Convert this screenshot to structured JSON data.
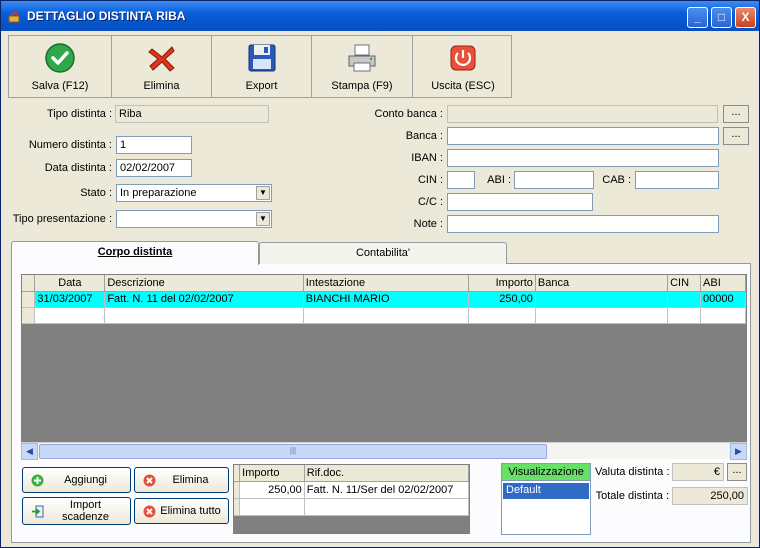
{
  "window": {
    "title": "DETTAGLIO DISTINTA RIBA",
    "controls": [
      "_",
      "□",
      "X"
    ]
  },
  "toolbar": {
    "buttons": [
      {
        "label": "Salva (F12)",
        "icon": "check-icon"
      },
      {
        "label": "Elimina",
        "icon": "delete-x-icon"
      },
      {
        "label": "Export",
        "icon": "floppy-disk-icon"
      },
      {
        "label": "Stampa (F9)",
        "icon": "printer-icon"
      },
      {
        "label": "Uscita (ESC)",
        "icon": "power-icon"
      }
    ]
  },
  "form": {
    "tipo_distinta": {
      "label": "Tipo distinta :",
      "value": "Riba"
    },
    "numero_distinta": {
      "label": "Numero distinta :",
      "value": "1"
    },
    "data_distinta": {
      "label": "Data distinta :",
      "value": "02/02/2007"
    },
    "stato": {
      "label": "Stato :",
      "value": "In preparazione"
    },
    "tipo_presentazione": {
      "label": "Tipo presentazione :",
      "value": ""
    },
    "conto_banca": {
      "label": "Conto banca :",
      "value": ""
    },
    "banca": {
      "label": "Banca :",
      "value": ""
    },
    "iban": {
      "label": "IBAN :",
      "value": ""
    },
    "cin": {
      "label": "CIN :",
      "value": ""
    },
    "abi": {
      "label": "ABI :",
      "value": ""
    },
    "cab": {
      "label": "CAB :",
      "value": ""
    },
    "cc": {
      "label": "C/C :",
      "value": ""
    },
    "note": {
      "label": "Note :",
      "value": ""
    },
    "dots": "..."
  },
  "tabs": [
    {
      "label": "Corpo distinta",
      "active": true
    },
    {
      "label": "Contabilita'",
      "active": false
    }
  ],
  "grid": {
    "columns": [
      "Data",
      "Descrizione",
      "Intestazione",
      "Importo",
      "Banca",
      "CIN",
      "ABI"
    ],
    "rows": [
      [
        "31/03/2007",
        "Fatt. N. 11 del 02/02/2007",
        "BIANCHI MARIO",
        "250,00",
        "",
        "",
        "00000"
      ],
      [
        "",
        "",
        "",
        "",
        "",
        "",
        ""
      ]
    ],
    "scroll_grip": "|||"
  },
  "actions": {
    "aggiungi": "Aggiungi",
    "elimina": "Elimina",
    "import_scadenze_line1": "Import",
    "import_scadenze_line2": "scadenze",
    "elimina_tutto": "Elimina tutto"
  },
  "ref_grid": {
    "columns": [
      "Importo",
      "Rif.doc."
    ],
    "rows": [
      [
        "250,00",
        "Fatt. N. 11/Ser del 02/02/2007"
      ],
      [
        "",
        ""
      ]
    ]
  },
  "visualizzazione": {
    "header": "Visualizzazione",
    "items": [
      "Default"
    ]
  },
  "summary": {
    "valuta_label": "Valuta distinta :",
    "valuta_value": "€",
    "totale_label": "Totale distinta :",
    "totale_value": "250,00"
  },
  "colors": {
    "titlebar": "#0a5fd8",
    "selected_row": "#00ffff",
    "vis_header": "#66e066",
    "list_selected": "#316ac5"
  }
}
